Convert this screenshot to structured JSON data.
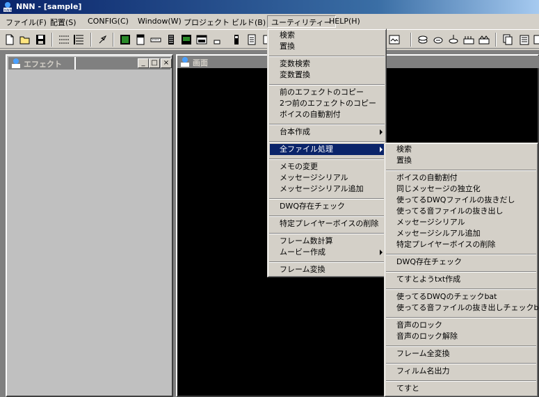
{
  "window": {
    "title": "NNN - [sample]"
  },
  "menubar": [
    "ファイル(F)",
    "配置(S)",
    "CONFIG(C)",
    "Window(W)",
    "プロジェクト",
    "ビルド(B)",
    "ユーティリティー",
    "HELP(H)"
  ],
  "panels": {
    "effect_title": "エフェクト",
    "screen_title": "画面"
  },
  "utility_menu": {
    "items": [
      "検索",
      "置換",
      "変数検索",
      "変数置換",
      "前のエフェクトのコピー",
      "2つ前のエフェクトのコピー",
      "ボイスの自動割付",
      "台本作成",
      "全ファイル処理",
      "メモの変更",
      "メッセージシリアル",
      "メッセージシリアル追加",
      "DWQ存在チェック",
      "特定プレイヤーボイスの削除",
      "フレーム数計算",
      "ムービー作成",
      "フレーム変換"
    ]
  },
  "allfiles_submenu": {
    "items": [
      "検索",
      "置換",
      "ボイスの自動割付",
      "同じメッセージの独立化",
      "使ってるDWQファイルの抜きだし",
      "使ってる音ファイルの抜き出し",
      "メッセージシリアル",
      "メッセージシルアル追加",
      "特定プレイヤーボイスの削除",
      "DWQ存在チェック",
      "てすとようtxt作成",
      "使ってるDWQのチェックbat",
      "使ってる音ファイルの抜き出しチェックbat",
      "音声のロック",
      "音声のロック解除",
      "フレーム全変換",
      "フィルム名出力",
      "てすと"
    ]
  },
  "colors": {
    "highlight": "#0a246a",
    "face": "#d4d0c8",
    "titlebar": "#0a246a",
    "inactive_title": "#808080"
  }
}
